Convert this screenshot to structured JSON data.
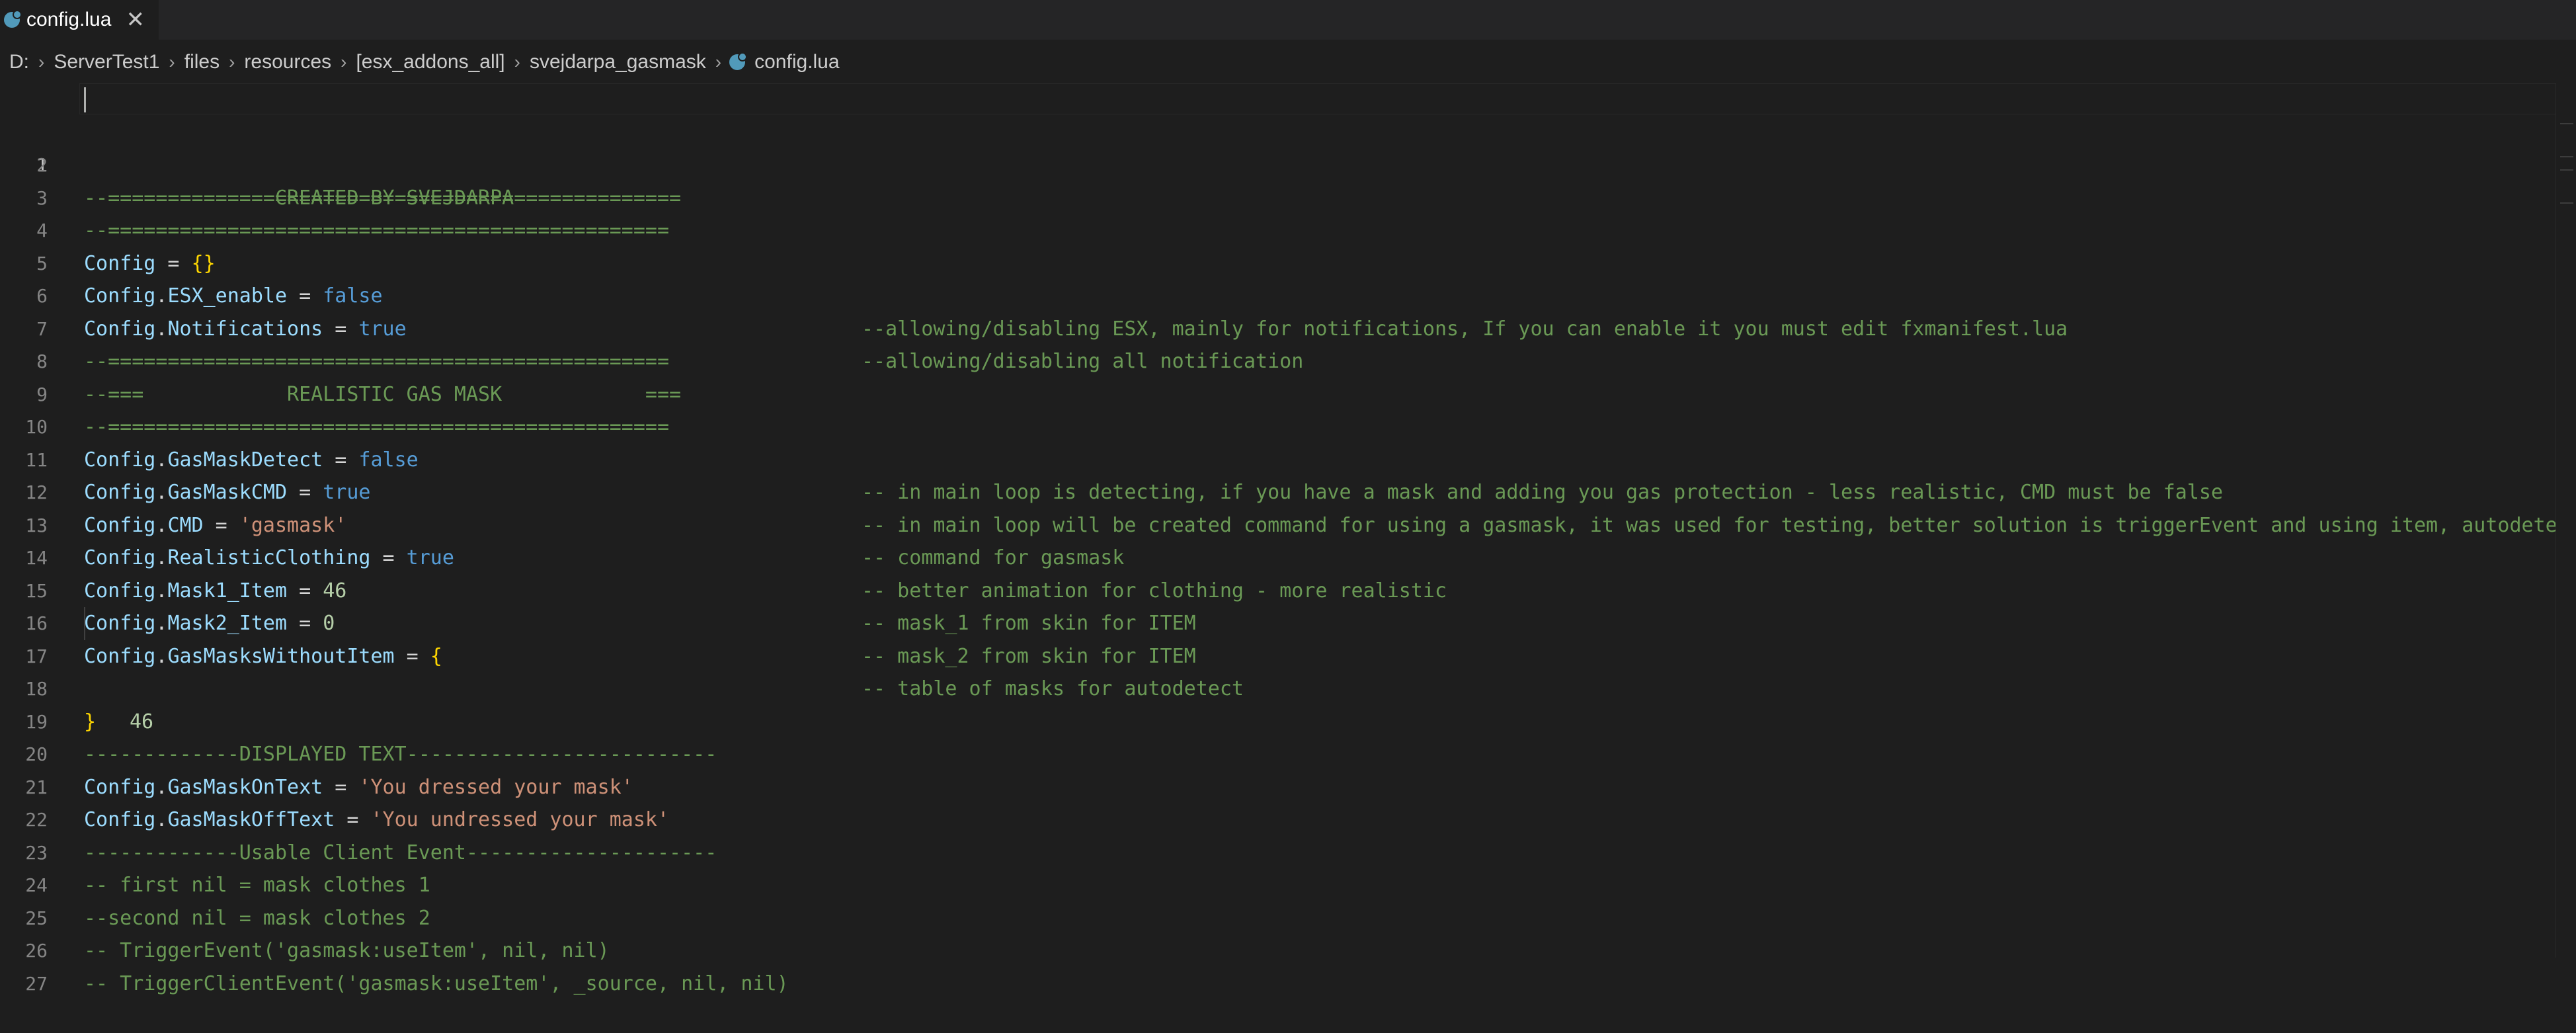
{
  "tab": {
    "label": "config.lua",
    "close": "✕"
  },
  "breadcrumb": [
    "D:",
    "ServerTest1",
    "files",
    "resources",
    "[esx_addons_all]",
    "svejdarpa_gasmask",
    "config.lua"
  ],
  "editor": {
    "lines": [
      {
        "n": "1"
      },
      {
        "n": "2"
      },
      {
        "n": "3"
      },
      {
        "n": "4"
      },
      {
        "n": "5"
      },
      {
        "n": "6"
      },
      {
        "n": "7"
      },
      {
        "n": "8"
      },
      {
        "n": "9"
      },
      {
        "n": "10"
      },
      {
        "n": "11"
      },
      {
        "n": "12"
      },
      {
        "n": "13"
      },
      {
        "n": "14"
      },
      {
        "n": "15"
      },
      {
        "n": "16"
      },
      {
        "n": "17"
      },
      {
        "n": "18"
      },
      {
        "n": "19"
      },
      {
        "n": "20"
      },
      {
        "n": "21"
      },
      {
        "n": "22"
      },
      {
        "n": "23"
      },
      {
        "n": "24"
      },
      {
        "n": "25"
      },
      {
        "n": "26"
      },
      {
        "n": "27"
      }
    ],
    "sep": "--===============================================",
    "header_created": "--===           CREATED BY SVEJDARPA           ===",
    "header_gas": "--===            REALISTIC GAS MASK            ===",
    "config": "Config",
    "eq": " = ",
    "dot": ".",
    "empty_table": "{}",
    "open_brace": "{",
    "close_brace": "}",
    "false": "false",
    "true": "true",
    "l5": {
      "prop": "ESX_enable",
      "comment": "--allowing/disabling ESX, mainly for notifications, If you can enable it you must edit fxmanifest.lua"
    },
    "l6": {
      "prop": "Notifications",
      "comment": "--allowing/disabling all notification"
    },
    "l10": {
      "prop": "GasMaskDetect",
      "comment": "-- in main loop is detecting, if you have a mask and adding you gas protection - less realistic, CMD must be false"
    },
    "l11": {
      "prop": "GasMaskCMD",
      "comment": "-- in main loop will be created command for using a gasmask, it was used for testing, better solution is triggerEvent and using item, autodetect MUST"
    },
    "l12": {
      "prop": "CMD",
      "value": "'gasmask'",
      "comment": "-- command for gasmask"
    },
    "l13": {
      "prop": "RealisticClothing",
      "comment": "-- better animation for clothing - more realistic"
    },
    "l14": {
      "prop": "Mask1_Item",
      "value": "46",
      "comment": "-- mask_1 from skin for ITEM"
    },
    "l15": {
      "prop": "Mask2_Item",
      "value": "0",
      "comment": "-- mask_2 from skin for ITEM"
    },
    "l16": {
      "prop": "GasMasksWithoutItem",
      "comment": "-- table of masks for autodetect"
    },
    "l17": {
      "value": "46"
    },
    "l19": "-------------DISPLAYED TEXT--------------------------",
    "l20": {
      "prop": "GasMaskOnText",
      "value": "'You dressed your mask'"
    },
    "l21": {
      "prop": "GasMaskOffText",
      "value": "'You undressed your mask'"
    },
    "l22": "-------------Usable Client Event---------------------",
    "l23": "-- first nil = mask clothes 1",
    "l24": "--second nil = mask clothes 2",
    "l25": "-- TriggerEvent('gasmask:useItem', nil, nil)",
    "l26": "-- TriggerClientEvent('gasmask:useItem', _source, nil, nil)"
  },
  "colors": {
    "background": "#1e1e1e",
    "comment": "#6a9955",
    "variable": "#9cdcfe",
    "keyword": "#569cd6",
    "string": "#ce9178",
    "number": "#b5cea8",
    "bracket": "#ffd700"
  }
}
